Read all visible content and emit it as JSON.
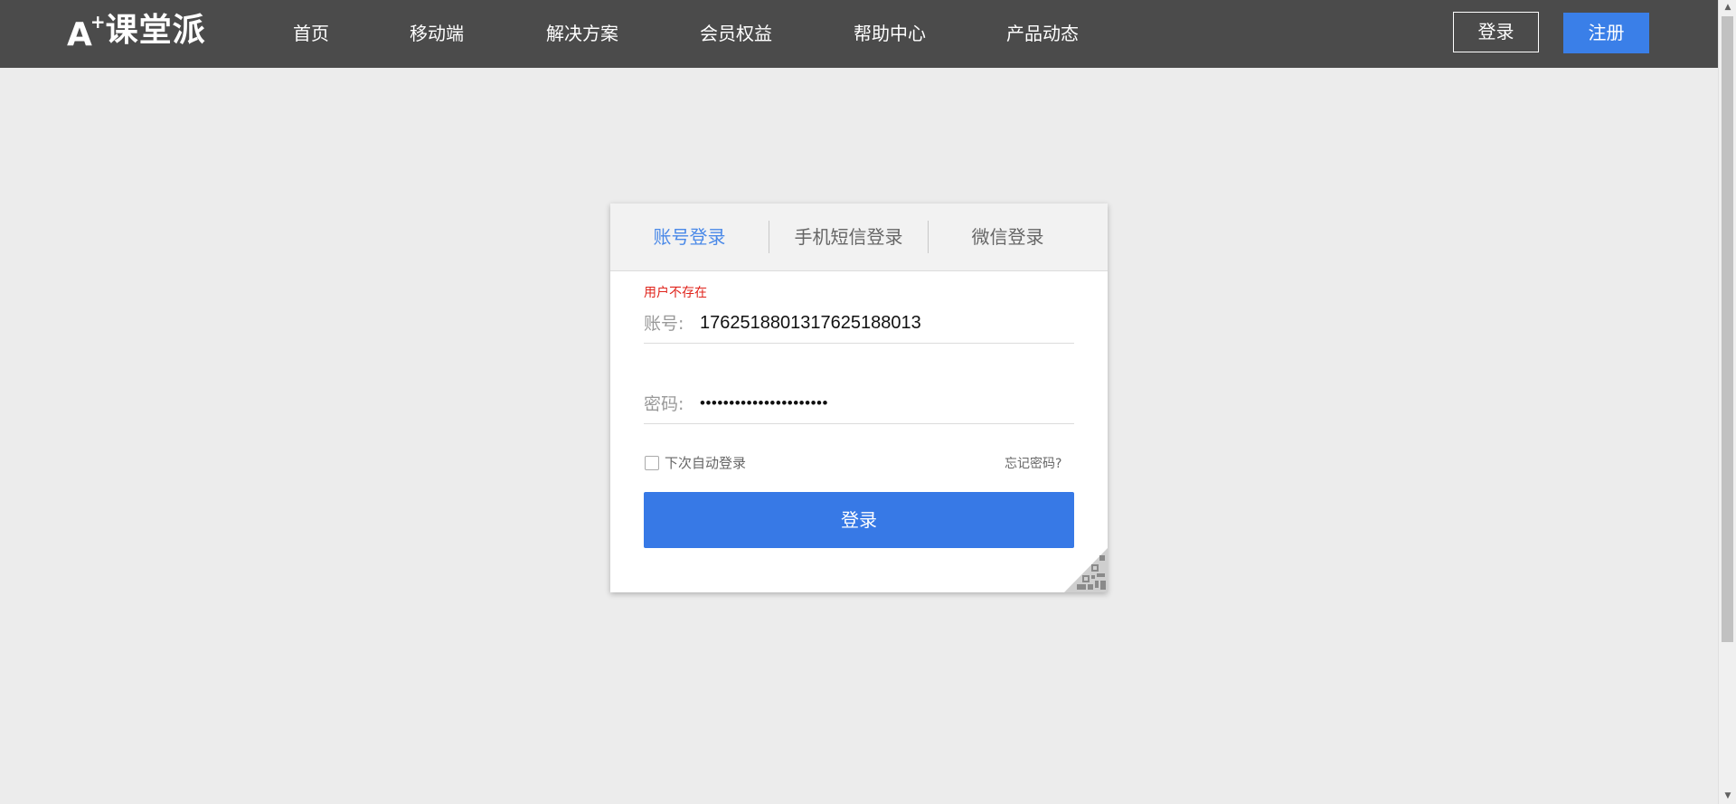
{
  "header": {
    "logo": {
      "mark": "A",
      "plus": "+",
      "text": "课堂派"
    },
    "nav": [
      {
        "label": "首页"
      },
      {
        "label": "移动端"
      },
      {
        "label": "解决方案"
      },
      {
        "label": "会员权益"
      },
      {
        "label": "帮助中心"
      },
      {
        "label": "产品动态"
      }
    ],
    "login_label": "登录",
    "register_label": "注册"
  },
  "login_card": {
    "tabs": [
      {
        "label": "账号登录",
        "active": true
      },
      {
        "label": "手机短信登录",
        "active": false
      },
      {
        "label": "微信登录",
        "active": false
      }
    ],
    "error_message": "用户不存在",
    "account": {
      "label": "账号:",
      "value": "17625188013176251880​13"
    },
    "password": {
      "label": "密码:",
      "value": "••••••••••••••••••••••"
    },
    "remember_label": "下次自动登录",
    "remember_checked": false,
    "forgot_label": "忘记密码?",
    "submit_label": "登录",
    "qr_icon": "qr-code-icon"
  },
  "colors": {
    "header_bg": "#4b4b4b",
    "page_bg": "#ececec",
    "accent": "#3779e6",
    "active_tab": "#4a89e8",
    "error": "#e0241c"
  }
}
